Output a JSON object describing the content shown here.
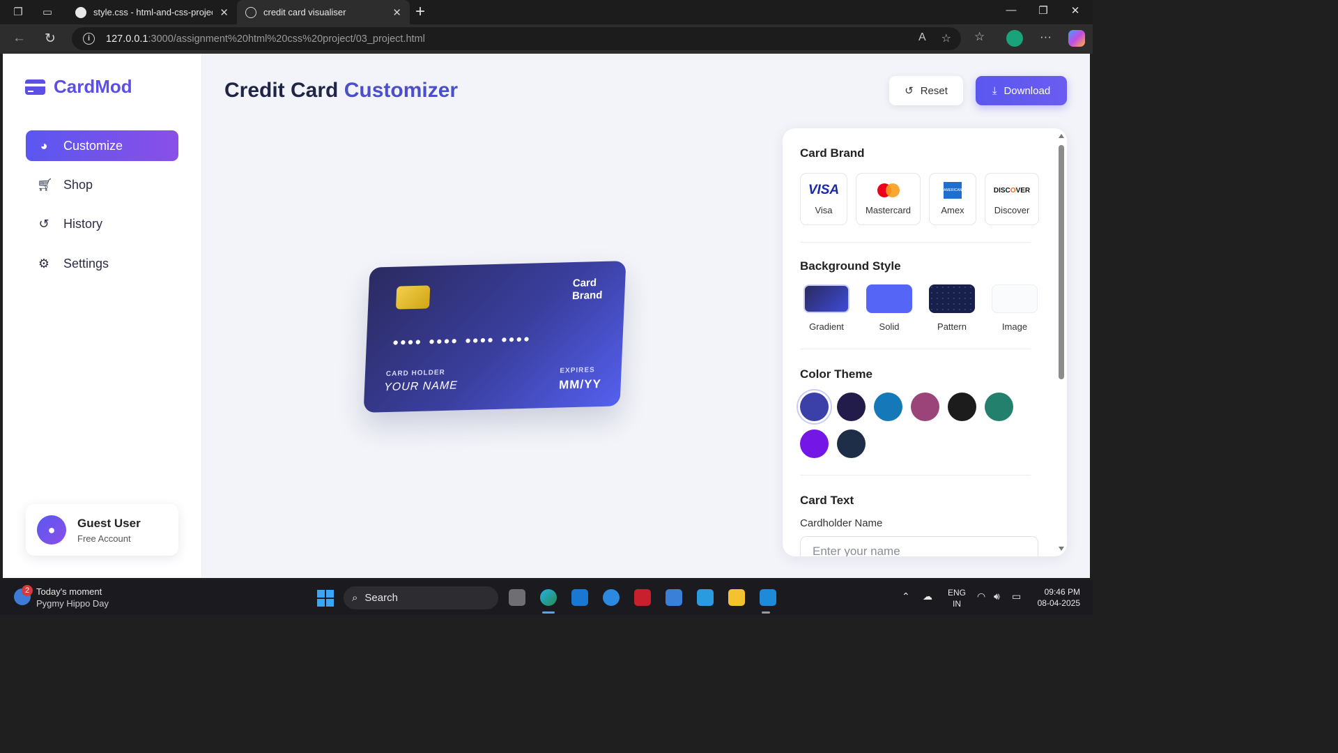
{
  "browser": {
    "tabs": [
      {
        "title": "style.css - html-and-css-project- [",
        "active": false
      },
      {
        "title": "credit card visualiser",
        "active": true
      }
    ],
    "url_host": "127.0.0.1",
    "url_path": ":3000/assignment%20html%20css%20project/03_project.html"
  },
  "app": {
    "logo": "CardMod",
    "title_part1": "Credit Card",
    "title_part2": "Customizer",
    "nav": [
      {
        "label": "Customize",
        "icon": "palette-icon",
        "active": true
      },
      {
        "label": "Shop",
        "icon": "cart-icon",
        "active": false
      },
      {
        "label": "History",
        "icon": "history-icon",
        "active": false
      },
      {
        "label": "Settings",
        "icon": "gear-icon",
        "active": false
      }
    ],
    "user": {
      "name": "Guest User",
      "plan": "Free Account"
    },
    "actions": {
      "reset": "Reset",
      "download": "Download"
    },
    "card": {
      "brand_line1": "Card",
      "brand_line2": "Brand",
      "number": "•••• •••• •••• ••••",
      "holder_label": "CARD HOLDER",
      "holder_value": "YOUR NAME",
      "expires_label": "EXPIRES",
      "expires_value": "MM/YY"
    },
    "panel": {
      "brand_title": "Card Brand",
      "brands": [
        "Visa",
        "Mastercard",
        "Amex",
        "Discover"
      ],
      "brand_logos": {
        "visa": "VISA",
        "mastercard": "mastercard",
        "amex": "AMERICAN EXPRESS",
        "discover_pre": "DISC",
        "discover_o": "O",
        "discover_post": "VER"
      },
      "bg_title": "Background Style",
      "bg_styles": [
        "Gradient",
        "Solid",
        "Pattern",
        "Image"
      ],
      "color_title": "Color Theme",
      "colors": [
        "#3b3fa8",
        "#221c4a",
        "#1578b8",
        "#9a4479",
        "#1c1c1c",
        "#22806c",
        "#7417e6",
        "#1e2e48"
      ],
      "selected_color": 0,
      "text_title": "Card Text",
      "cardholder_label": "Cardholder Name",
      "cardholder_placeholder": "Enter your name"
    }
  },
  "taskbar": {
    "news_title": "Today's moment",
    "news_sub": "Pygmy Hippo Day",
    "news_badge": "2",
    "search": "Search",
    "lang_line1": "ENG",
    "lang_line2": "IN",
    "time": "09:46 PM",
    "date": "08-04-2025"
  }
}
